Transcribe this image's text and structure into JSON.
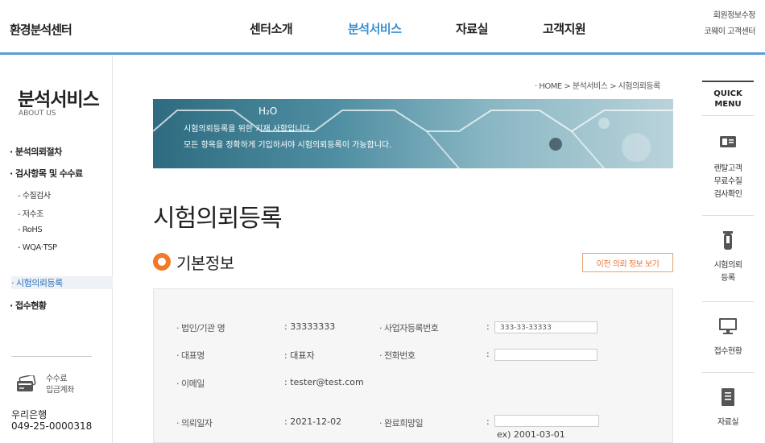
{
  "header": {
    "logo": "환경분석센터",
    "nav": [
      "센터소개",
      "분석서비스",
      "자료실",
      "고객지원"
    ],
    "active_nav": "분석서비스",
    "util": [
      "회원정보수정",
      "코웨이 고객센터"
    ],
    "accent_color": "#3a8fd0"
  },
  "sidebar": {
    "title": "분석서비스",
    "subtitle": "ABOUT US",
    "items": [
      {
        "label": "· 분석의뢰절차"
      },
      {
        "label": "· 검사항목 및 수수료"
      },
      {
        "label": "- 수질검사"
      },
      {
        "label": "- 저수조"
      },
      {
        "label": "- RoHS"
      },
      {
        "label": "- WQA·TSP"
      },
      {
        "label": "· 시험의뢰등록"
      },
      {
        "label": "· 접수현황"
      }
    ],
    "current": "· 시험의뢰등록",
    "bank": {
      "label_line1": "수수료",
      "label_line2": "입금계좌",
      "icon": "card-icon",
      "name": "우리은행",
      "account": "049-25-0000318"
    }
  },
  "quick": {
    "title_line1": "QUICK",
    "title_line2": "MENU",
    "items": [
      {
        "icon": "id-card-icon",
        "line1": "렌탈고객",
        "line2": "무료수질",
        "line3": "검사확인"
      },
      {
        "icon": "test-tube-icon",
        "line1": "시험의뢰",
        "line2": "등록",
        "line3": ""
      },
      {
        "icon": "monitor-icon",
        "line1": "접수현황",
        "line2": "",
        "line3": ""
      },
      {
        "icon": "document-icon",
        "line1": "자료실",
        "line2": "",
        "line3": ""
      }
    ]
  },
  "breadcrumb": "· HOME > 분석서비스 > 시험의뢰등록",
  "banner": {
    "h2o": "H₂O",
    "line1": "시험의뢰등록을 위한 기재 사항입니다.",
    "line2": "모든 항목을 정확하게 기입하셔야 시험의뢰등록이 가능합니다."
  },
  "page_title": "시험의뢰등록",
  "section": {
    "title": "기본정보",
    "prev_button": "이전 의뢰 정보 보기",
    "accent_color": "#f07a2a"
  },
  "form": {
    "company_label": "· 법인/기관 명",
    "company_value": ": 33333333",
    "bizno_label": "· 사업자등록번호",
    "bizno_colon": ":",
    "bizno_value": "333-33-33333",
    "rep_label": "· 대표명",
    "rep_value": ": 대표자",
    "phone_label": "· 전화번호",
    "phone_colon": ":",
    "phone_value": "",
    "email_label": "· 이메일",
    "email_value": ": tester@test.com",
    "reqdate_label": "· 의뢰일자",
    "reqdate_value": ": 2021-12-02",
    "duedate_label": "· 완료희망일",
    "duedate_colon": ":",
    "duedate_value": "",
    "duedate_hint": "ex) 2001-03-01"
  }
}
